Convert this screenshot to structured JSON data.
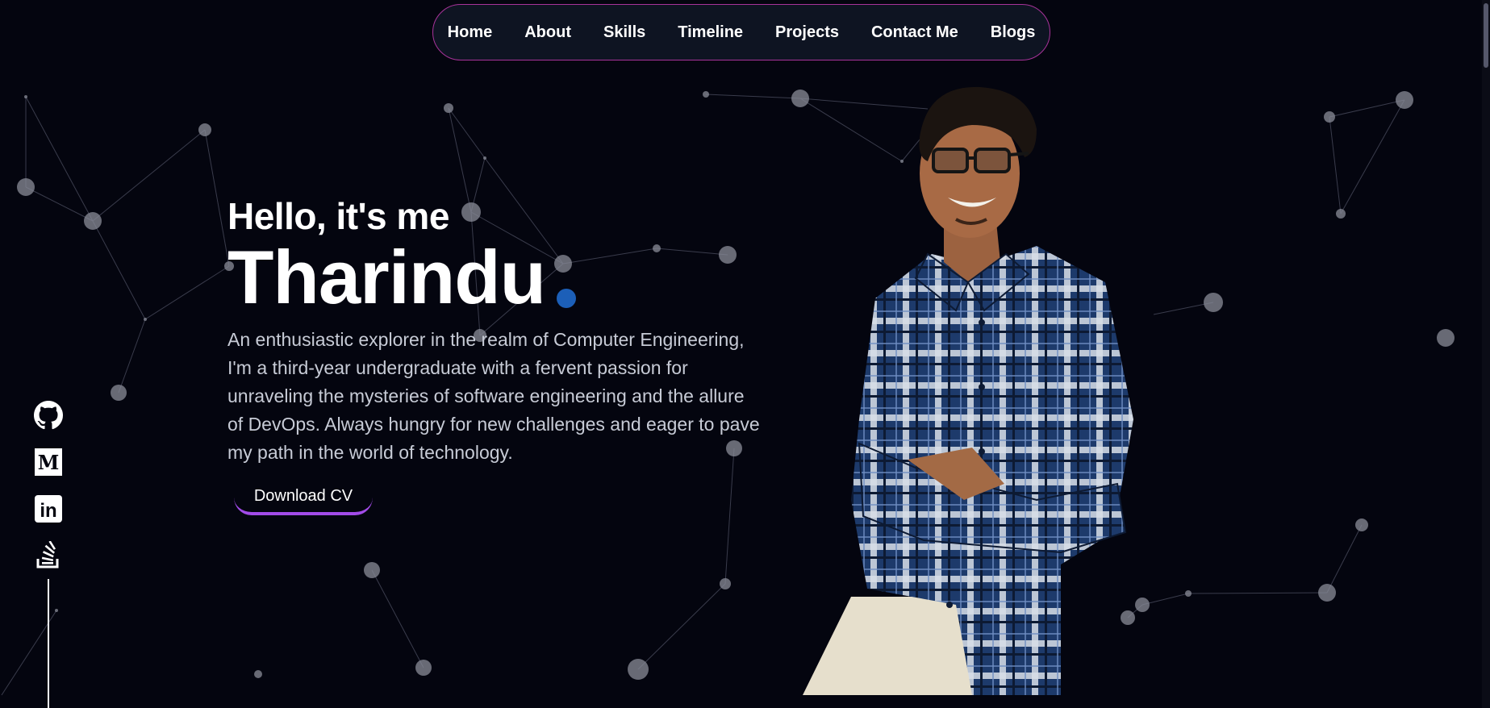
{
  "nav": {
    "items": [
      {
        "label": "Home"
      },
      {
        "label": "About"
      },
      {
        "label": "Skills"
      },
      {
        "label": "Timeline"
      },
      {
        "label": "Projects"
      },
      {
        "label": "Contact Me"
      },
      {
        "label": "Blogs"
      }
    ]
  },
  "hero": {
    "greeting": "Hello, it's me",
    "name": "Tharindu",
    "bio": "An enthusiastic explorer in the realm of Computer Engineering, I'm a third-year undergraduate with a fervent passion for unraveling the mysteries of software engineering and the allure of DevOps. Always hungry for new challenges and eager to pave my path in the world of technology.",
    "cv_button": "Download CV"
  },
  "social": {
    "icons": [
      "github-icon",
      "medium-icon",
      "linkedin-icon",
      "stackoverflow-icon"
    ],
    "medium_letter": "M",
    "linkedin_letters": "in"
  },
  "colors": {
    "background": "#04050f",
    "nav_border": "#a8339a",
    "accent_dot": "#1c5fb8",
    "cv_underline": "#a24be8",
    "bio_text": "#c7cbd6"
  }
}
